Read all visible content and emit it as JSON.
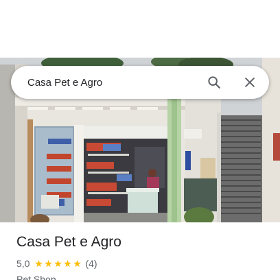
{
  "search": {
    "query": "Casa Pet e Agro"
  },
  "place": {
    "name": "Casa Pet e Agro",
    "rating": "5,0",
    "stars": 5,
    "review_count": "(4)",
    "category": "Pet Shop"
  },
  "icons": {
    "search": "search-icon",
    "close": "close-icon",
    "star": "star-icon"
  },
  "colors": {
    "star": "#fbbc04",
    "icon": "#5f6368",
    "text_primary": "#202124",
    "text_secondary": "#5f6368"
  }
}
